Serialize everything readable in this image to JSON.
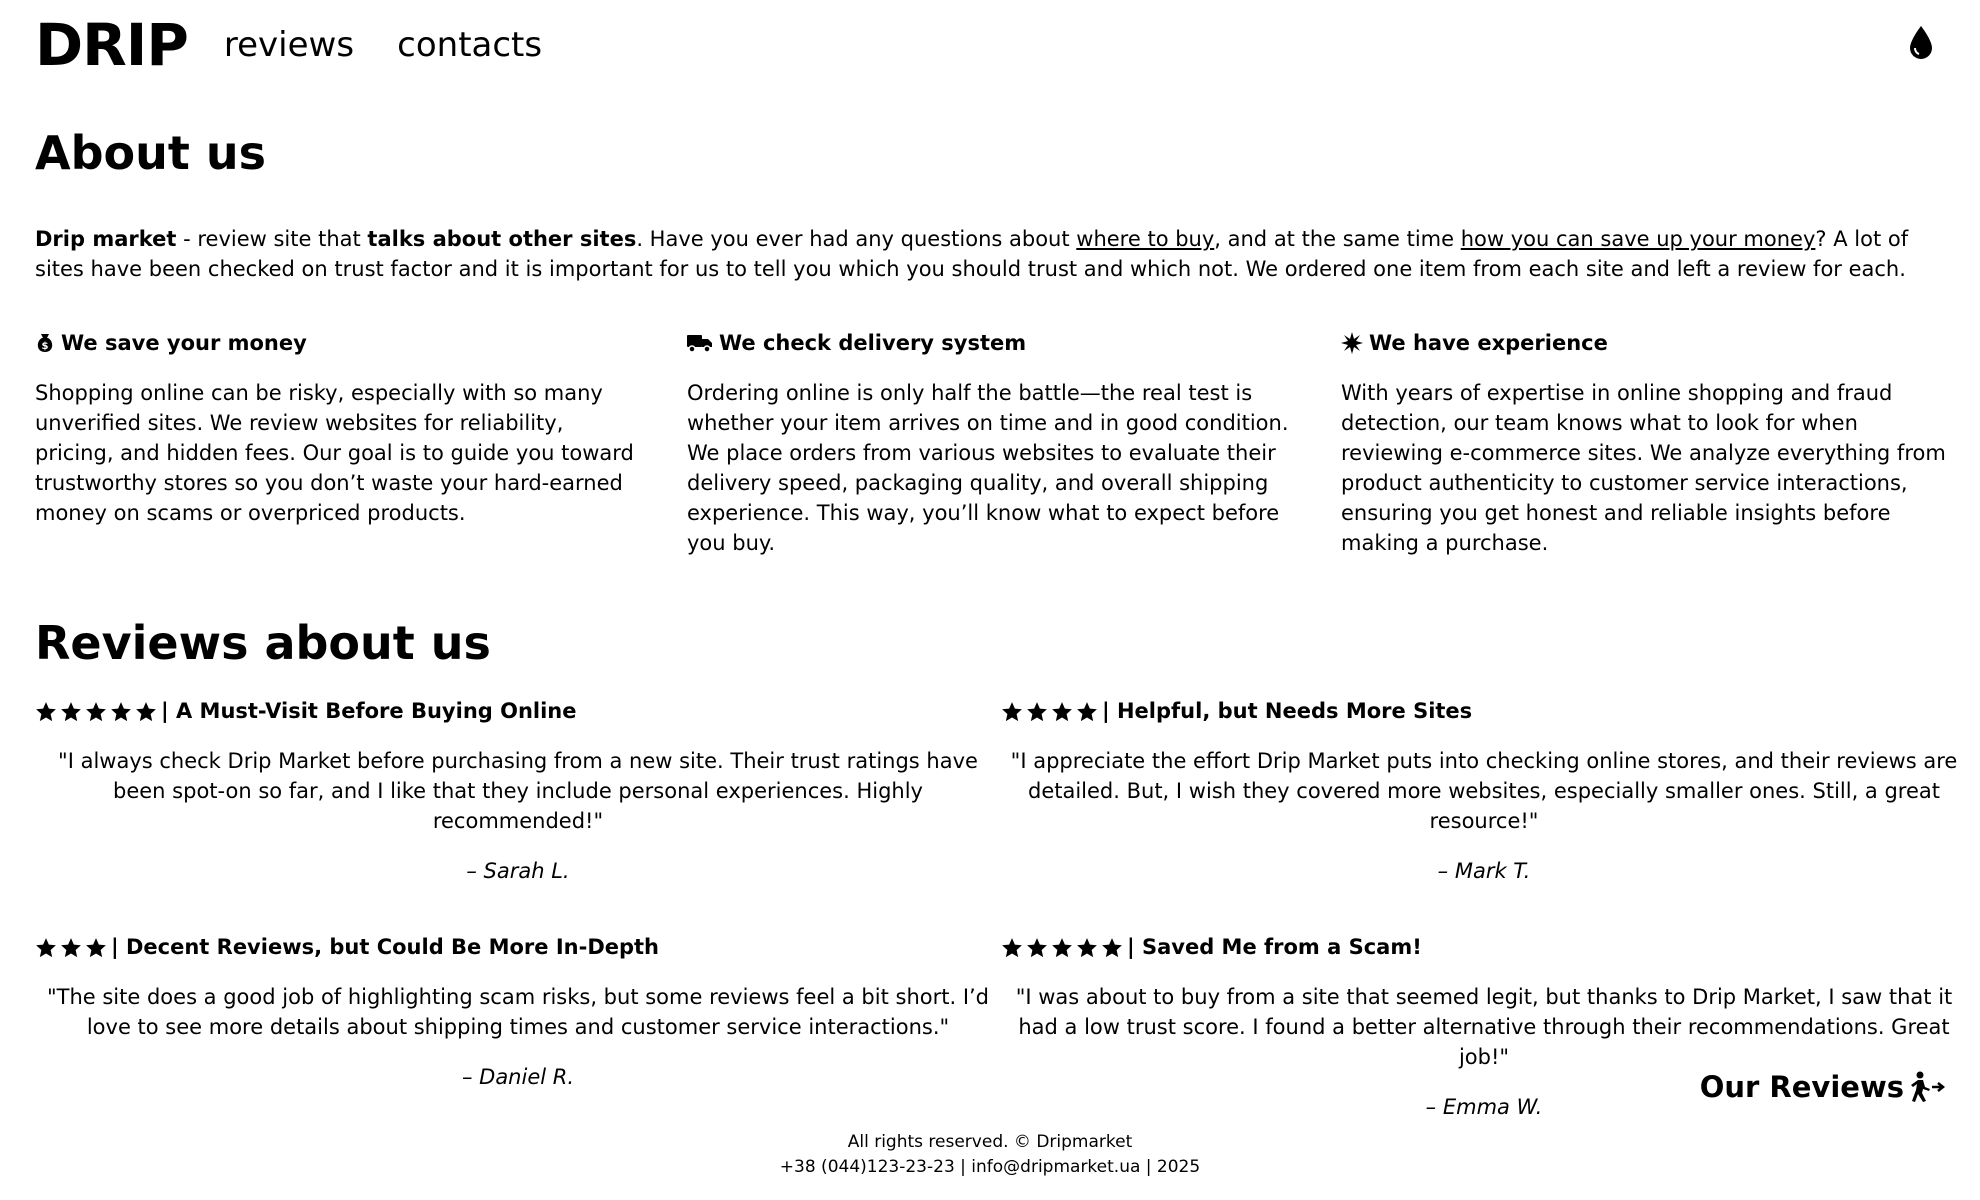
{
  "header": {
    "logo": "DRIP",
    "nav": [
      "reviews",
      "contacts"
    ],
    "theme_icon": "drop-icon"
  },
  "about": {
    "title": "About us",
    "intro": {
      "brand": "Drip market",
      "t1": " - review site that ",
      "bold1": "talks about other sites",
      "t2": ". Have you ever had any questions about ",
      "link1": "where to buy",
      "t3": ", and at the same time ",
      "link2": "how you can save up your money",
      "t4": "? A lot of sites have been checked on trust factor and it is important for us to tell you which you should trust and which not. We ordered one item from each site and left a review for each."
    },
    "features": [
      {
        "icon": "money-bag-icon",
        "title": "We save your money",
        "text": "Shopping online can be risky, especially with so many unverified sites. We review websites for reliability, pricing, and hidden fees. Our goal is to guide you toward trustworthy stores so you don’t waste your hard-earned money on scams or overpriced products."
      },
      {
        "icon": "truck-icon",
        "title": "We check delivery system",
        "text": "Ordering online is only half the battle—the real test is whether your item arrives on time and in good condition. We place orders from various websites to evaluate their delivery speed, packaging quality, and overall shipping experience. This way, you’ll know what to expect before you buy."
      },
      {
        "icon": "burst-icon",
        "title": "We have experience",
        "text": "With years of expertise in online shopping and fraud detection, our team knows what to look for when reviewing e-commerce sites. We analyze everything from product authenticity to customer service interactions, ensuring you get honest and reliable insights before making a purchase."
      }
    ]
  },
  "reviews": {
    "title": "Reviews about us",
    "items": [
      {
        "stars": 5,
        "title": "| A Must-Visit Before Buying Online",
        "quote": "\"I always check Drip Market before purchasing from a new site. Their trust ratings have been spot-on so far, and I like that they include personal experiences. Highly recommended!\"",
        "author": "– Sarah L."
      },
      {
        "stars": 4,
        "title": "| Helpful, but Needs More Sites",
        "quote": "\"I appreciate the effort Drip Market puts into checking online stores, and their reviews are detailed. But, I wish they covered more websites, especially smaller ones. Still, a great resource!\"",
        "author": "– Mark T."
      },
      {
        "stars": 3,
        "title": "| Decent Reviews, but Could Be More In-Depth",
        "quote": "\"The site does a good job of highlighting scam risks, but some reviews feel a bit short. I’d love to see more details about shipping times and customer service interactions.\"",
        "author": "– Daniel R."
      },
      {
        "stars": 5,
        "title": "| Saved Me from a Scam!",
        "quote": "\"I was about to buy from a site that seemed legit, but thanks to Drip Market, I saw that it had a low trust score. I found a better alternative through their recommendations. Great job!\"",
        "author": "– Emma W."
      }
    ],
    "link_label": "Our Reviews",
    "link_icon": "walking-arrow-icon"
  },
  "footer": {
    "line1": "All rights reserved. © Dripmarket",
    "line2": "+38 (044)123-23-23 | info@dripmarket.ua | 2025"
  }
}
